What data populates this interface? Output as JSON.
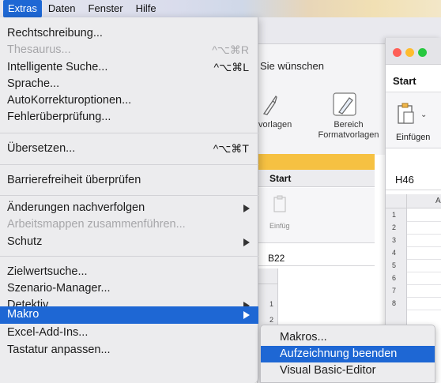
{
  "menubar": {
    "items": [
      "Extras",
      "Daten",
      "Fenster",
      "Hilfe"
    ],
    "active_index": 0
  },
  "extras_menu": {
    "items": [
      {
        "label": "Rechtschreibung...",
        "shortcut": "",
        "enabled": true,
        "submenu": false
      },
      {
        "label": "Thesaurus...",
        "shortcut": "^⌥⌘R",
        "enabled": false,
        "submenu": false
      },
      {
        "label": "Intelligente Suche...",
        "shortcut": "^⌥⌘L",
        "enabled": true,
        "submenu": false
      },
      {
        "label": "Sprache...",
        "shortcut": "",
        "enabled": true,
        "submenu": false
      },
      {
        "label": "AutoKorrekturoptionen...",
        "shortcut": "",
        "enabled": true,
        "submenu": false
      },
      {
        "label": "Fehlerüberprüfung...",
        "shortcut": "",
        "enabled": true,
        "submenu": false
      },
      {
        "label": "Übersetzen...",
        "shortcut": "^⌥⌘T",
        "enabled": true,
        "submenu": false
      },
      {
        "label": "Barrierefreiheit überprüfen",
        "shortcut": "",
        "enabled": true,
        "submenu": false
      },
      {
        "label": "Änderungen nachverfolgen",
        "shortcut": "",
        "enabled": true,
        "submenu": true
      },
      {
        "label": "Arbeitsmappen zusammenführen...",
        "shortcut": "",
        "enabled": false,
        "submenu": false
      },
      {
        "label": "Schutz",
        "shortcut": "",
        "enabled": true,
        "submenu": true
      },
      {
        "label": "Zielwertsuche...",
        "shortcut": "",
        "enabled": true,
        "submenu": false
      },
      {
        "label": "Szenario-Manager...",
        "shortcut": "",
        "enabled": true,
        "submenu": false
      },
      {
        "label": "Detektiv",
        "shortcut": "",
        "enabled": true,
        "submenu": true
      },
      {
        "label": "Makro",
        "shortcut": "",
        "enabled": true,
        "submenu": true,
        "highlighted": true
      },
      {
        "label": "Excel-Add-Ins...",
        "shortcut": "",
        "enabled": true,
        "submenu": false
      },
      {
        "label": "Tastatur anpassen...",
        "shortcut": "",
        "enabled": true,
        "submenu": false
      }
    ]
  },
  "makro_submenu": {
    "items": [
      {
        "label": "Makros...",
        "highlighted": false
      },
      {
        "label": "Aufzeichnung beenden",
        "highlighted": true
      },
      {
        "label": "Visual Basic-Editor",
        "highlighted": false
      }
    ]
  },
  "background": {
    "ribbon_hint": "Sie wünschen",
    "label_vorlagen": "vorlagen",
    "label_bereich": "Bereich Formatvorlagen",
    "mid_window": {
      "tab": "Start",
      "paste_label": "Einfüg",
      "cell_ref": "B22",
      "rows": [
        "1",
        "2"
      ]
    },
    "right_window": {
      "tab": "Start",
      "paste_label": "Einfügen",
      "cell_ref": "H46",
      "column": "A",
      "rows": [
        "1",
        "2",
        "3",
        "4",
        "5",
        "6",
        "7",
        "8"
      ]
    }
  },
  "colors": {
    "accent": "#1e67d4",
    "menu_bg": "#ececee",
    "disabled_text": "#a7a7aa",
    "window_close": "#fe5f57",
    "window_min": "#febc2e",
    "window_max": "#28c840"
  }
}
